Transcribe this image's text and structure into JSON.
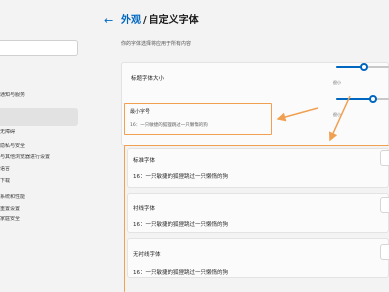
{
  "breadcrumb": {
    "parent": "外观",
    "separator": "/",
    "current": "自定义字体"
  },
  "subtitle": "你的字体选择将应用于所有内容",
  "sidebar": {
    "items": [
      {
        "label": "通知与服务"
      },
      {
        "label": ""
      },
      {
        "label": "无障碍"
      },
      {
        "label": "隐私与安全"
      },
      {
        "label": "与其他浏览器进行设置"
      },
      {
        "label": "语言"
      },
      {
        "label": "下载"
      },
      {
        "label": "系统和性能"
      },
      {
        "label": "重置设置"
      },
      {
        "label": "家庭安全"
      }
    ]
  },
  "settings": {
    "heading_size_label": "标题字体大小",
    "small_label": "很小",
    "min_size": {
      "title": "最小字号",
      "sample": "16：一只敏捷的狐狸跳过一只懒惰的狗"
    },
    "standard": {
      "title": "标准字体",
      "sample": "16：一只敏捷的狐狸跳过一只懒惰的狗"
    },
    "serif": {
      "title": "衬线字体",
      "sample": "16：一只敏捷的狐狸跳过一只懒惰的狗"
    },
    "sans": {
      "title": "无衬线字体",
      "sample": "16：一只敏捷的狐狸跳过一只懒惰的狗"
    }
  },
  "colors": {
    "accent": "#0067c0",
    "highlight": "#f0a050"
  }
}
